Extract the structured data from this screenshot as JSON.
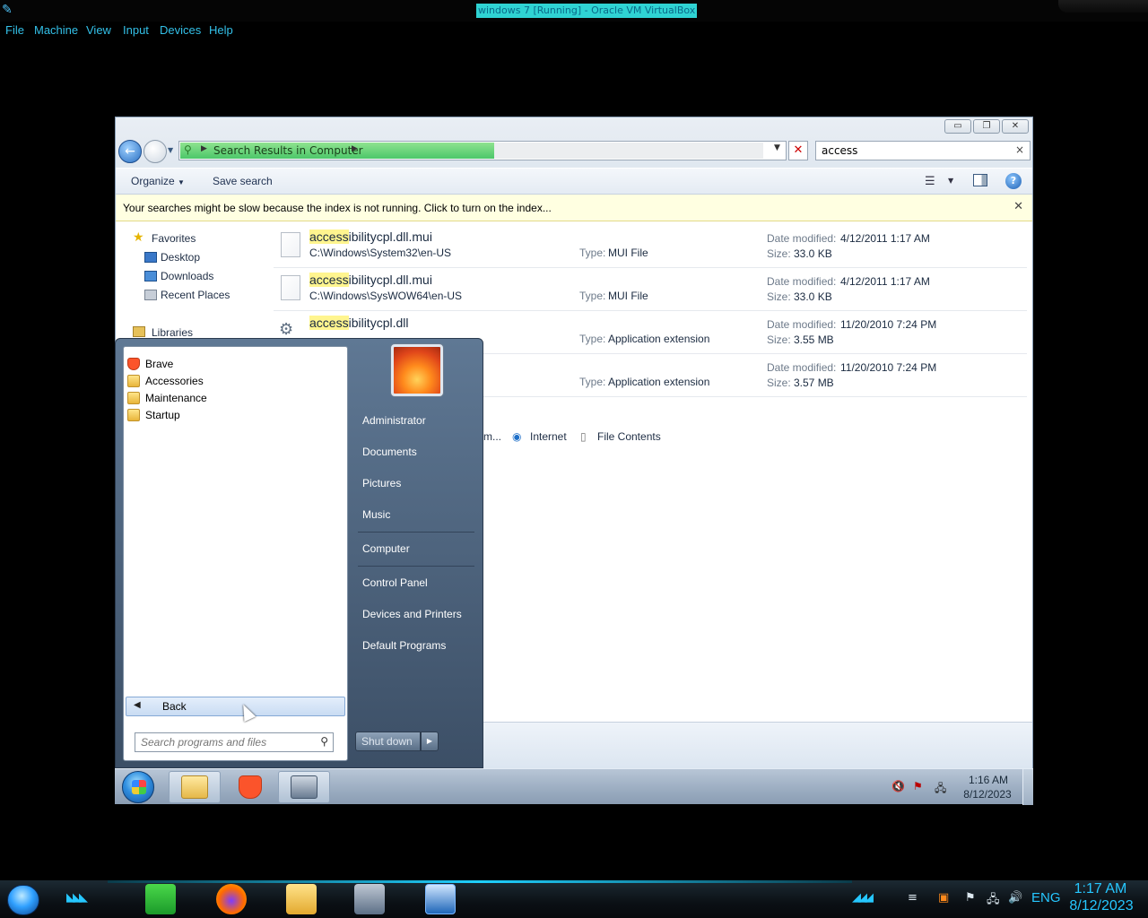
{
  "host": {
    "window_title": "windows 7 [Running] - Oracle VM VirtualBox",
    "menu": [
      "File",
      "Machine",
      "View",
      "Input",
      "Devices",
      "Help"
    ],
    "taskbar": {
      "language": "ENG",
      "time": "1:17 AM",
      "date": "8/12/2023"
    }
  },
  "explorer": {
    "window_controls": {
      "minimize": "▭",
      "maximize": "❐",
      "close": "✕"
    },
    "address": "Search Results in Computer",
    "search_value": "access",
    "toolbar": {
      "organize": "Organize",
      "save_search": "Save search"
    },
    "infobar": "Your searches might be slow because the index is not running.  Click to turn on the index...",
    "nav": {
      "favorites": "Favorites",
      "desktop": "Desktop",
      "downloads": "Downloads",
      "recent_places": "Recent Places",
      "libraries": "Libraries"
    },
    "labels": {
      "type": "Type:",
      "date_modified": "Date modified:",
      "size": "Size:"
    },
    "results": [
      {
        "highlight": "access",
        "name_rest": "ibilitycpl.dll.mui",
        "path": "C:\\Windows\\System32\\en-US",
        "type": "MUI File",
        "date": "4/12/2011 1:17 AM",
        "size": "33.0 KB",
        "icon": "file-icon"
      },
      {
        "highlight": "access",
        "name_rest": "ibilitycpl.dll.mui",
        "path": "C:\\Windows\\SysWOW64\\en-US",
        "type": "MUI File",
        "date": "4/12/2011 1:17 AM",
        "size": "33.0 KB",
        "icon": "file-icon"
      },
      {
        "highlight": "access",
        "name_rest": "ibilitycpl.dll",
        "path": "",
        "type": "Application extension",
        "date": "11/20/2010 7:24 PM",
        "size": "3.55 MB",
        "icon": "gear-file-icon"
      },
      {
        "highlight": "",
        "name_rest": "",
        "path": "",
        "type": "Application extension",
        "date": "11/20/2010 7:24 PM",
        "size": "3.57 MB",
        "icon": ""
      }
    ],
    "search_again": {
      "partial": "m...",
      "internet": "Internet",
      "file_contents": "File Contents"
    }
  },
  "start_menu": {
    "programs": [
      {
        "label": "Brave",
        "icon": "brave-icon"
      },
      {
        "label": "Accessories",
        "icon": "folder-icon"
      },
      {
        "label": "Maintenance",
        "icon": "folder-icon"
      },
      {
        "label": "Startup",
        "icon": "folder-icon"
      }
    ],
    "back_label": "Back",
    "search_placeholder": "Search programs and files",
    "places": [
      "Administrator",
      "Documents",
      "Pictures",
      "Music",
      "Computer",
      "Control Panel",
      "Devices and Printers",
      "Default Programs"
    ],
    "shutdown_label": "Shut down"
  },
  "guest_taskbar": {
    "time": "1:16 AM",
    "date": "8/12/2023"
  }
}
